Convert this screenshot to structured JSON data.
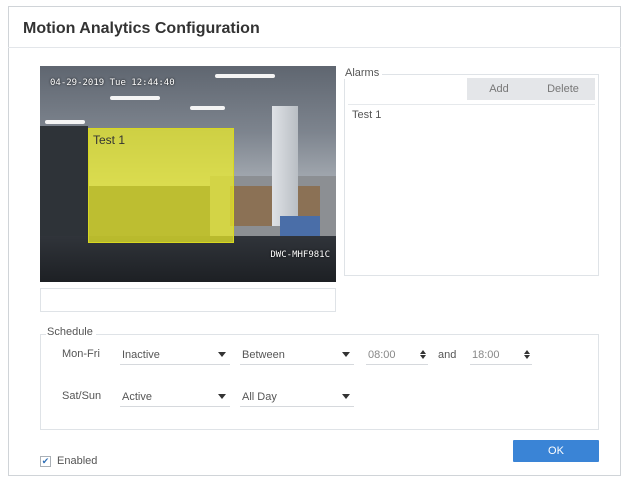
{
  "dialog": {
    "title": "Motion Analytics Configuration"
  },
  "video": {
    "timestamp": "04-29-2019 Tue 12:44:40",
    "camera_label": "DWC-MHF981C",
    "zone_label": "Test 1",
    "zone_color": "#eeee28"
  },
  "alarms": {
    "legend": "Alarms",
    "add_label": "Add",
    "delete_label": "Delete",
    "items": [
      "Test 1"
    ]
  },
  "schedule": {
    "legend": "Schedule",
    "weekday": {
      "label": "Mon-Fri",
      "state": "Inactive",
      "mode": "Between",
      "start": "08:00",
      "and_label": "and",
      "end": "18:00"
    },
    "weekend": {
      "label": "Sat/Sun",
      "state": "Active",
      "mode": "All Day"
    }
  },
  "footer": {
    "enabled_label": "Enabled",
    "enabled_checked": true,
    "ok_label": "OK",
    "accent_color": "#3a84d6"
  }
}
